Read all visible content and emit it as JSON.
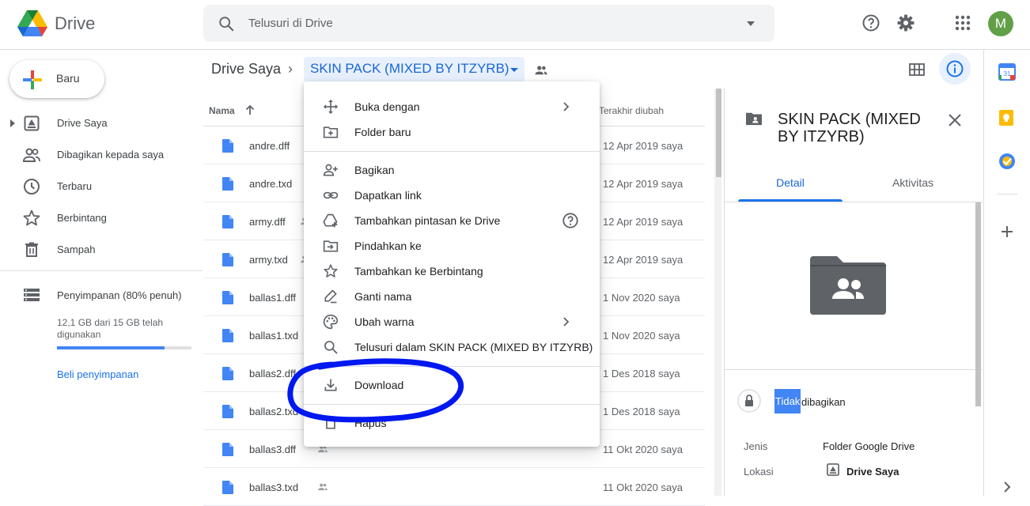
{
  "app": {
    "name": "Drive"
  },
  "search": {
    "placeholder": "Telusuri di Drive"
  },
  "header": {
    "avatar_letter": "M",
    "avatar_color": "#62a048"
  },
  "sidebar": {
    "new_label": "Baru",
    "items": [
      {
        "label": "Drive Saya",
        "icon": "drive-icon"
      },
      {
        "label": "Dibagikan kepada saya",
        "icon": "people-icon"
      },
      {
        "label": "Terbaru",
        "icon": "clock-icon"
      },
      {
        "label": "Berbintang",
        "icon": "star-icon"
      },
      {
        "label": "Sampah",
        "icon": "trash-icon"
      }
    ],
    "storage": {
      "label": "Penyimpanan (80% penuh)",
      "detail": "12,1 GB dari 15 GB telah digunakan",
      "used_fraction": 0.8,
      "buy_label": "Beli penyimpanan"
    }
  },
  "breadcrumb": {
    "root": "Drive Saya",
    "separator": "›",
    "current": "SKIN PACK (MIXED BY ITZYRB)"
  },
  "file_list": {
    "col_name": "Nama",
    "col_modified": "Terakhir diubah",
    "rows": [
      {
        "name": "andre.dff",
        "date": "12 Apr 2019  saya"
      },
      {
        "name": "andre.txd",
        "date": "12 Apr 2019  saya"
      },
      {
        "name": "army.dff",
        "date": "12 Apr 2019  saya"
      },
      {
        "name": "army.txd",
        "date": "12 Apr 2019  saya"
      },
      {
        "name": "ballas1.dff",
        "date": "1 Nov 2020  saya"
      },
      {
        "name": "ballas1.txd",
        "date": "1 Nov 2020  saya"
      },
      {
        "name": "ballas2.dff",
        "date": "1 Des 2018  saya"
      },
      {
        "name": "ballas2.txd",
        "date": "1 Des 2018  saya"
      },
      {
        "name": "ballas3.dff",
        "date": "11 Okt 2020  saya"
      },
      {
        "name": "ballas3.txd",
        "date": "11 Okt 2020  saya"
      }
    ]
  },
  "context_menu": {
    "items": [
      {
        "label": "Buka dengan",
        "icon": "open-with-icon"
      },
      {
        "label": "Folder baru",
        "icon": "new-folder-icon"
      },
      {
        "label": "Bagikan",
        "icon": "share-person-icon"
      },
      {
        "label": "Dapatkan link",
        "icon": "link-icon"
      },
      {
        "label": "Tambahkan pintasan ke Drive",
        "icon": "add-shortcut-icon"
      },
      {
        "label": "Pindahkan ke",
        "icon": "move-to-icon"
      },
      {
        "label": "Tambahkan ke Berbintang",
        "icon": "star-icon"
      },
      {
        "label": "Ganti nama",
        "icon": "rename-icon"
      },
      {
        "label": "Ubah warna",
        "icon": "palette-icon"
      },
      {
        "label": "Telusuri dalam SKIN PACK (MIXED BY ITZYRB)",
        "icon": "search-icon"
      },
      {
        "label": "Download",
        "icon": "download-icon"
      },
      {
        "label": "Hapus",
        "icon": "trash-icon"
      }
    ],
    "annotation_color": "#0018f0"
  },
  "detail_panel": {
    "title": "SKIN PACK (MIXED BY ITZYRB)",
    "tabs": [
      "Detail",
      "Aktivitas"
    ],
    "share_status_highlight": "Tidak",
    "share_status_rest": "dibagikan",
    "type_label": "Jenis",
    "type_value": "Folder Google Drive",
    "location_label": "Lokasi",
    "location_value": "Drive Saya"
  }
}
